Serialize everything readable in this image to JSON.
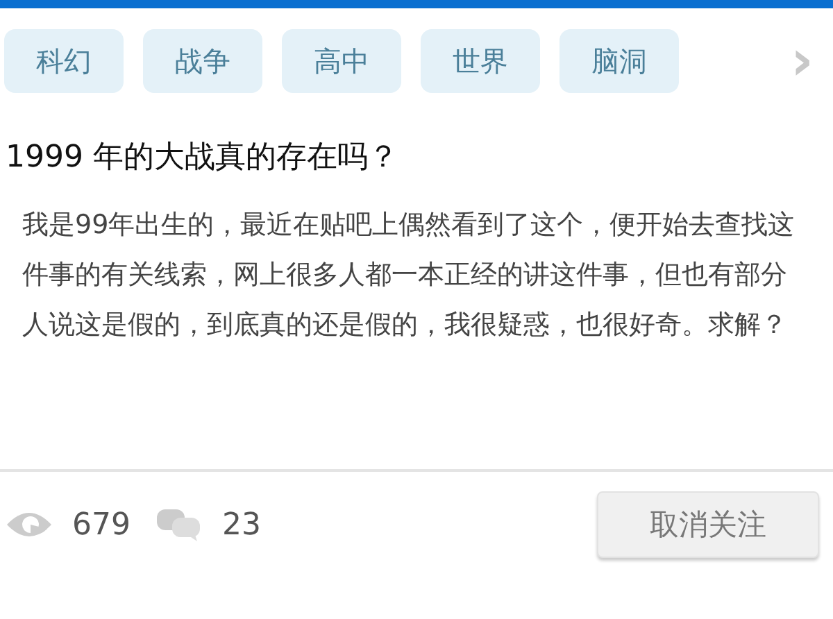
{
  "tags": [
    {
      "label": "科幻"
    },
    {
      "label": "战争"
    },
    {
      "label": "高中"
    },
    {
      "label": "世界"
    },
    {
      "label": "脑洞"
    }
  ],
  "more": "›",
  "question": {
    "title": "1999 年的大战真的存在吗？",
    "body": "我是99年出生的，最近在贴吧上偶然看到了这个，便开始去查找这件事的有关线索，网上很多人都一本正经的讲这件事，但也有部分人说这是假的，到底真的还是假的，我很疑惑，也很好奇。求解？"
  },
  "stats": {
    "views": "679",
    "comments": "23"
  },
  "follow_button": {
    "label": "取消关注",
    "disabled": true
  }
}
